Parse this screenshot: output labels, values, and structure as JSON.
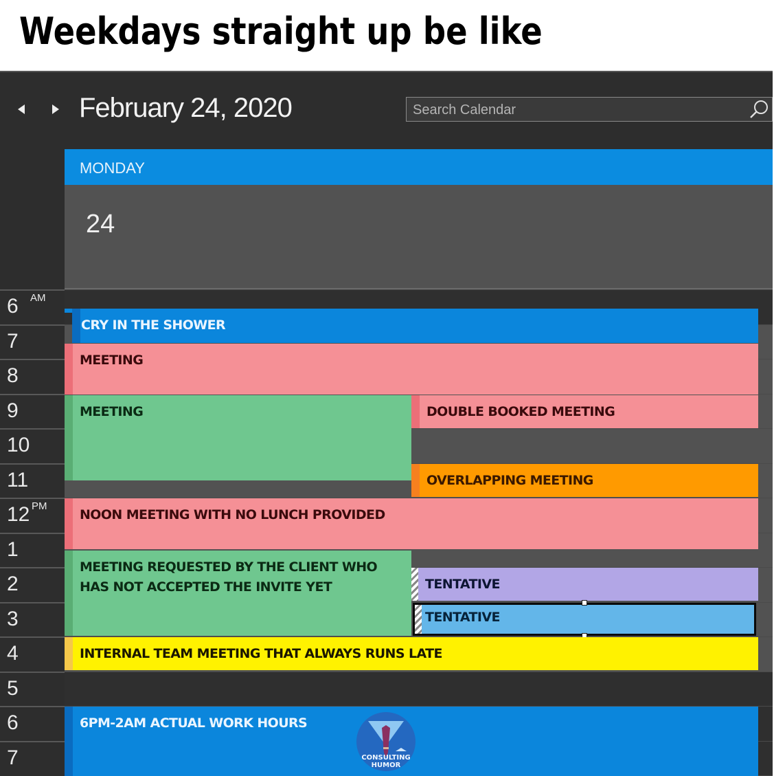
{
  "caption": "Weekdays straight up be like",
  "calendar": {
    "date_title": "February 24, 2020",
    "search": {
      "placeholder": "Search Calendar",
      "value": ""
    },
    "day": {
      "name": "MONDAY",
      "number": "24"
    },
    "hours": [
      {
        "num": "6",
        "ampm": "AM"
      },
      {
        "num": "7",
        "ampm": ""
      },
      {
        "num": "8",
        "ampm": ""
      },
      {
        "num": "9",
        "ampm": ""
      },
      {
        "num": "10",
        "ampm": ""
      },
      {
        "num": "11",
        "ampm": ""
      },
      {
        "num": "12",
        "ampm": "PM"
      },
      {
        "num": "1",
        "ampm": ""
      },
      {
        "num": "2",
        "ampm": ""
      },
      {
        "num": "3",
        "ampm": ""
      },
      {
        "num": "4",
        "ampm": ""
      },
      {
        "num": "5",
        "ampm": ""
      },
      {
        "num": "6",
        "ampm": ""
      },
      {
        "num": "7",
        "ampm": ""
      }
    ],
    "events": [
      {
        "id": "cry-in-the-shower",
        "title": "CRY IN THE SHOWER",
        "color": "#0b86dc",
        "bar": "#0a6cc0",
        "text": "#eaf5ff"
      },
      {
        "id": "meeting-7",
        "title": "MEETING",
        "color": "#f59096",
        "bar": "#ec6f78",
        "text": "#3a0a0c"
      },
      {
        "id": "meeting-9",
        "title": "MEETING",
        "color": "#6fc78f",
        "bar": "#5aae74",
        "text": "#0b2a14"
      },
      {
        "id": "double-booked",
        "title": "DOUBLE BOOKED MEETING",
        "color": "#f59096",
        "bar": "#ec6f78",
        "text": "#3a0a0c"
      },
      {
        "id": "overlapping",
        "title": "OVERLAPPING MEETING",
        "color": "#ff9a00",
        "bar": "#f6801f",
        "text": "#3a1800"
      },
      {
        "id": "noon-meeting",
        "title": "NOON MEETING WITH NO LUNCH PROVIDED",
        "color": "#f59096",
        "bar": "#ec6f78",
        "text": "#3a0a0c"
      },
      {
        "id": "client-meeting",
        "title": "MEETING REQUESTED BY THE CLIENT WHO HAS NOT ACCEPTED THE INVITE YET",
        "color": "#6fc78f",
        "bar": "#5aae74",
        "text": "#0b2a14"
      },
      {
        "id": "tentative-1",
        "title": "TENTATIVE",
        "color": "#b2a6e6",
        "bar": "",
        "text": "#0d1533"
      },
      {
        "id": "tentative-2",
        "title": "TENTATIVE",
        "color": "#63b6e9",
        "bar": "",
        "text": "#07233a"
      },
      {
        "id": "internal-team",
        "title": "INTERNAL TEAM MEETING THAT ALWAYS RUNS LATE",
        "color": "#fff200",
        "bar": "#f5c84a",
        "text": "#1a1600"
      },
      {
        "id": "actual-work",
        "title": "6PM-2AM ACTUAL WORK HOURS",
        "color": "#0b86dc",
        "bar": "#0a6cc0",
        "text": "#eaf5ff"
      }
    ]
  },
  "watermark": {
    "line1": "CONSULTING",
    "line2": "HUMOR"
  }
}
